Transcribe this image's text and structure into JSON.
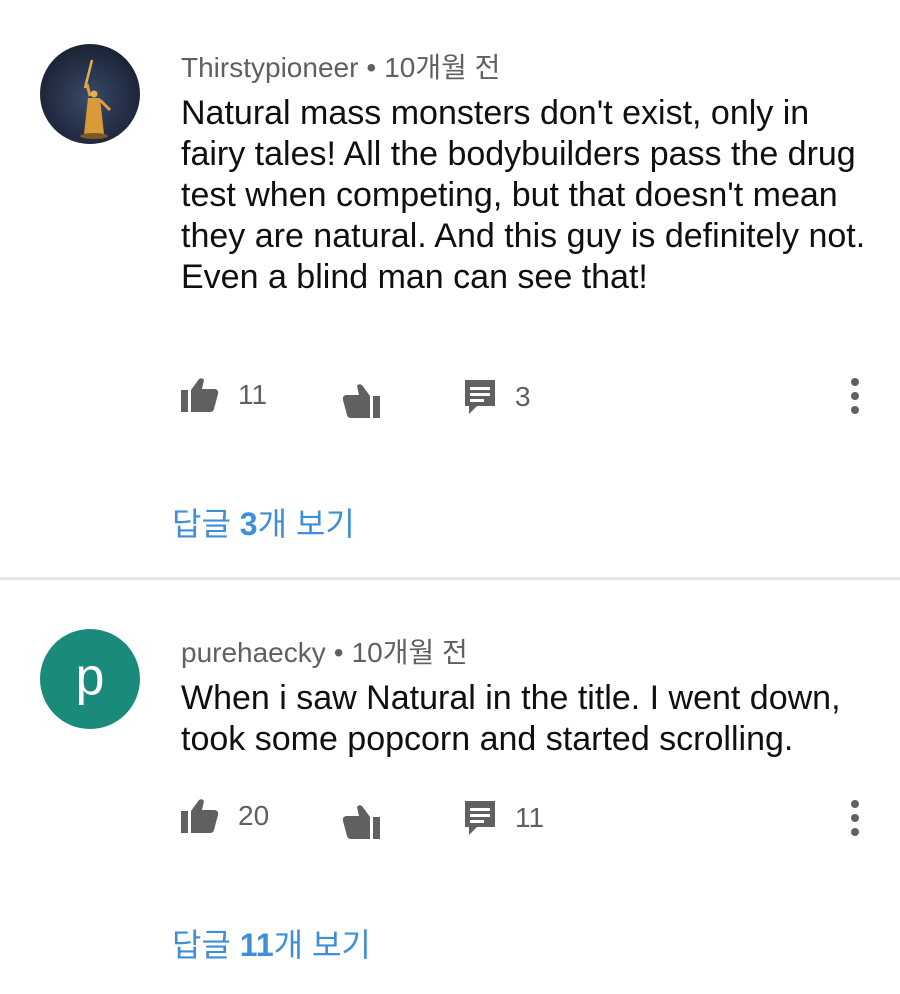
{
  "comments": [
    {
      "author": "Thirstypioneer",
      "separator": "•",
      "time": "10개월 전",
      "text": "Natural mass monsters don't exist, only in fairy tales! All the bodybuilders pass the drug test when competing, but that doesn't mean they are natural. And this guy is definitely not. Even a blind man can see that!",
      "likes": "11",
      "replies_count": "3",
      "replies_link": {
        "prefix": "답글 ",
        "num": "3",
        "suffix": "개 보기"
      },
      "avatar": {
        "kind": "image",
        "icon": "statue-avatar"
      }
    },
    {
      "author": "purehaecky",
      "separator": "•",
      "time": "10개월 전",
      "text": "When i saw Natural in the title. I went down, took some popcorn and started scrolling.",
      "likes": "20",
      "replies_count": "11",
      "replies_link": {
        "prefix": "답글 ",
        "num": "11",
        "suffix": "개 보기"
      },
      "avatar": {
        "kind": "letter",
        "letter": "p",
        "color": "#1a8a7a"
      }
    }
  ],
  "colors": {
    "link": "#3e8ed8",
    "meta": "#606060",
    "icon": "#606060",
    "divider": "#e5e5e5"
  }
}
